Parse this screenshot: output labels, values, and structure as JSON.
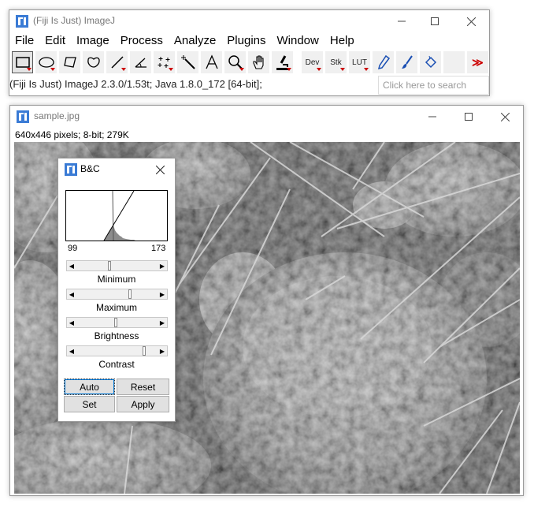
{
  "main_window": {
    "title": "(Fiji Is Just) ImageJ",
    "menu": [
      "File",
      "Edit",
      "Image",
      "Process",
      "Analyze",
      "Plugins",
      "Window",
      "Help"
    ],
    "tools": [
      {
        "name": "rectangle-tool",
        "icon": "rectangle-icon"
      },
      {
        "name": "oval-tool",
        "icon": "oval-icon"
      },
      {
        "name": "polygon-tool",
        "icon": "polygon-icon"
      },
      {
        "name": "freehand-tool",
        "icon": "freehand-icon"
      },
      {
        "name": "line-tool",
        "icon": "line-icon"
      },
      {
        "name": "angle-tool",
        "icon": "angle-icon"
      },
      {
        "name": "point-tool",
        "icon": "multipoint-icon"
      },
      {
        "name": "wand-tool",
        "icon": "wand-icon"
      },
      {
        "name": "text-tool",
        "icon": "text-icon"
      },
      {
        "name": "zoom-tool",
        "icon": "magnifier-icon"
      },
      {
        "name": "scroll-tool",
        "icon": "hand-icon"
      },
      {
        "name": "color-picker-tool",
        "icon": "microscope-icon"
      },
      {
        "name": "dev-menu",
        "label": "Dev"
      },
      {
        "name": "stack-menu",
        "label": "Stk"
      },
      {
        "name": "lut-menu",
        "label": "LUT"
      },
      {
        "name": "pencil-tool",
        "icon": "pencil-icon"
      },
      {
        "name": "brush-tool",
        "icon": "brush-icon"
      },
      {
        "name": "flood-fill-tool",
        "icon": "bucket-icon"
      },
      {
        "name": "more-tools",
        "label": "≫"
      }
    ],
    "status": "(Fiji Is Just) ImageJ 2.3.0/1.53t; Java 1.8.0_172 [64-bit];",
    "search_placeholder": "Click here to search"
  },
  "image_window": {
    "title": "sample.jpg",
    "info": "640x446 pixels; 8-bit; 279K"
  },
  "bc_dialog": {
    "title": "B&C",
    "hist_min": "99",
    "hist_max": "173",
    "minimum_label": "Minimum",
    "maximum_label": "Maximum",
    "brightness_label": "Brightness",
    "contrast_label": "Contrast",
    "auto_label": "Auto",
    "reset_label": "Reset",
    "set_label": "Set",
    "apply_label": "Apply"
  },
  "colors": {
    "accent_red": "#cc0000",
    "title_gray": "#777777"
  }
}
